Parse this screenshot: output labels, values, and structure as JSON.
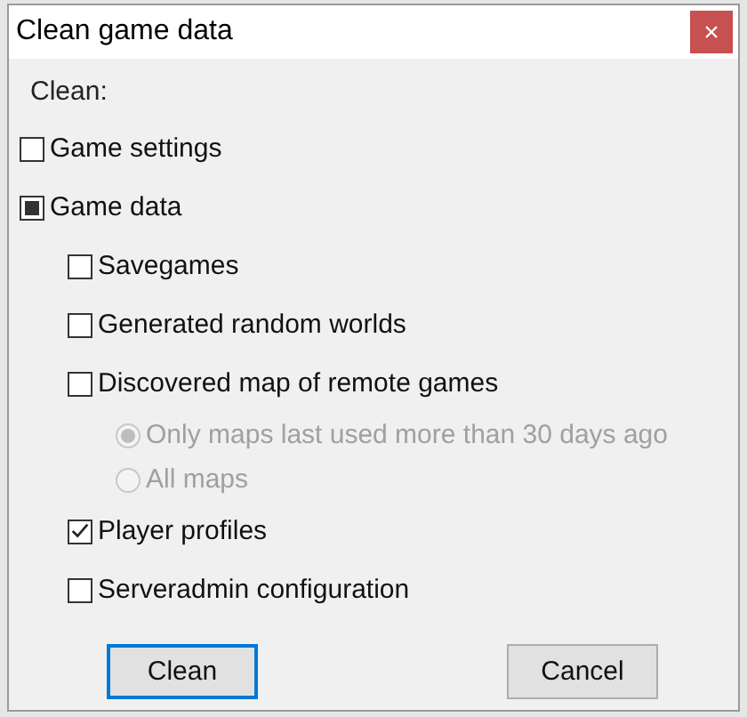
{
  "window": {
    "title": "Clean game data",
    "close": "×"
  },
  "section_label": "Clean:",
  "options": [
    {
      "kind": "checkbox",
      "label": "Game settings",
      "checked": false,
      "indeterminate": false
    },
    {
      "kind": "checkbox",
      "label": "Game data",
      "checked": false,
      "indeterminate": true,
      "children": [
        {
          "kind": "checkbox",
          "label": "Savegames",
          "checked": false,
          "indeterminate": false
        },
        {
          "kind": "checkbox",
          "label": "Generated random worlds",
          "checked": false,
          "indeterminate": false
        },
        {
          "kind": "checkbox",
          "label": "Discovered map of remote games",
          "checked": false,
          "indeterminate": false,
          "children": [
            {
              "kind": "radio",
              "label": "Only maps last used more than 30 days ago",
              "selected": true,
              "disabled": true
            },
            {
              "kind": "radio",
              "label": "All maps",
              "selected": false,
              "disabled": true
            }
          ]
        },
        {
          "kind": "checkbox",
          "label": "Player profiles",
          "checked": true,
          "indeterminate": false
        },
        {
          "kind": "checkbox",
          "label": "Serveradmin configuration",
          "checked": false,
          "indeterminate": false
        }
      ]
    }
  ],
  "buttons": [
    {
      "label": "Clean",
      "focused": true
    },
    {
      "label": "Cancel",
      "focused": false
    }
  ]
}
